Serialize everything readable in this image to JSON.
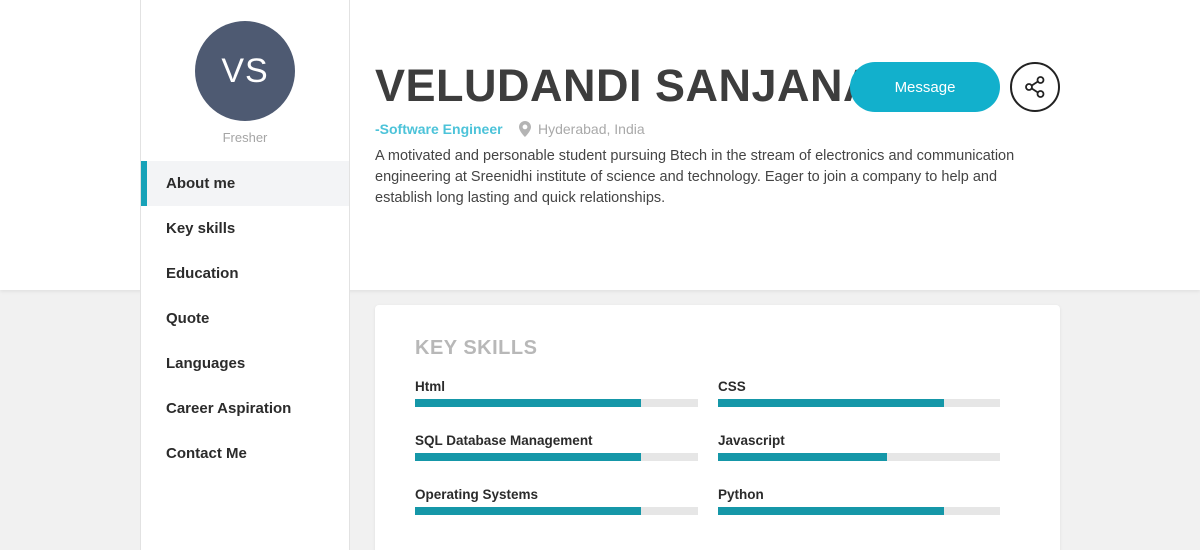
{
  "profile": {
    "initials": "VS",
    "status": "Fresher",
    "name": "VELUDANDI SANJANA",
    "role": "-Software Engineer",
    "location": "Hyderabad, India",
    "bio": "A motivated and personable student pursuing Btech in the stream of electronics and communication engineering at Sreenidhi institute of science and technology. Eager to join a company to help and establish long lasting and quick relationships.",
    "message_label": "Message",
    "share_icon": "share-icon",
    "location_icon": "map-pin-icon"
  },
  "nav": {
    "items": [
      {
        "label": "About me",
        "active": true
      },
      {
        "label": "Key skills",
        "active": false
      },
      {
        "label": "Education",
        "active": false
      },
      {
        "label": "Quote",
        "active": false
      },
      {
        "label": "Languages",
        "active": false
      },
      {
        "label": "Career Aspiration",
        "active": false
      },
      {
        "label": "Contact Me",
        "active": false
      }
    ]
  },
  "skills_card": {
    "title": "KEY SKILLS",
    "skills": [
      {
        "name": "Html",
        "level": 0.8
      },
      {
        "name": "CSS",
        "level": 0.8
      },
      {
        "name": "SQL Database Management",
        "level": 0.8
      },
      {
        "name": "Javascript",
        "level": 0.6
      },
      {
        "name": "Operating Systems",
        "level": 0.8
      },
      {
        "name": "Python",
        "level": 0.8
      }
    ]
  },
  "colors": {
    "accent": "#12b0cc",
    "bar_fill": "#1597a8",
    "bar_track": "#e6e6e6",
    "avatar_bg": "#4e5a72"
  }
}
